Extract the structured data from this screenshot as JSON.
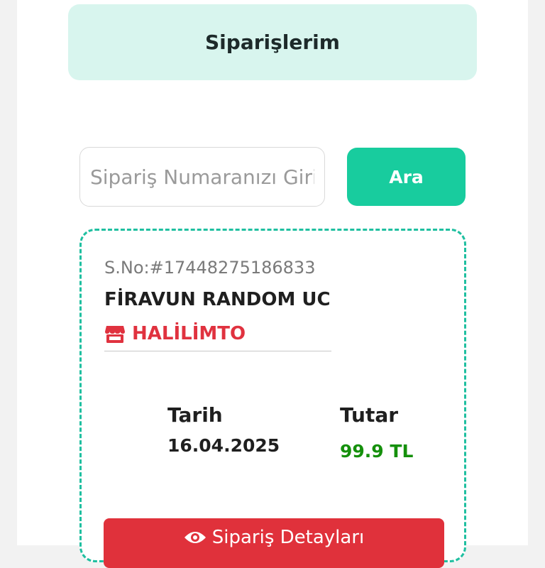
{
  "header": {
    "title": "Siparişlerim"
  },
  "search": {
    "placeholder": "Sipariş Numaranızı Girin",
    "button_label": "Ara"
  },
  "order": {
    "order_no": "S.No:#17448275186833",
    "product_name": "FİRAVUN RANDOM UC",
    "seller_icon": "store-icon",
    "seller_name": "HALİLİMTO",
    "date_label": "Tarih",
    "date_value": "16.04.2025",
    "amount_label": "Tutar",
    "amount_value": "99.9 TL",
    "details_icon": "eye-icon",
    "details_label": "Sipariş Detayları"
  },
  "colors": {
    "accent": "#18cc9e",
    "header_bg": "#d8f5ee",
    "danger": "#e0313b",
    "amount_green": "#15900c"
  }
}
